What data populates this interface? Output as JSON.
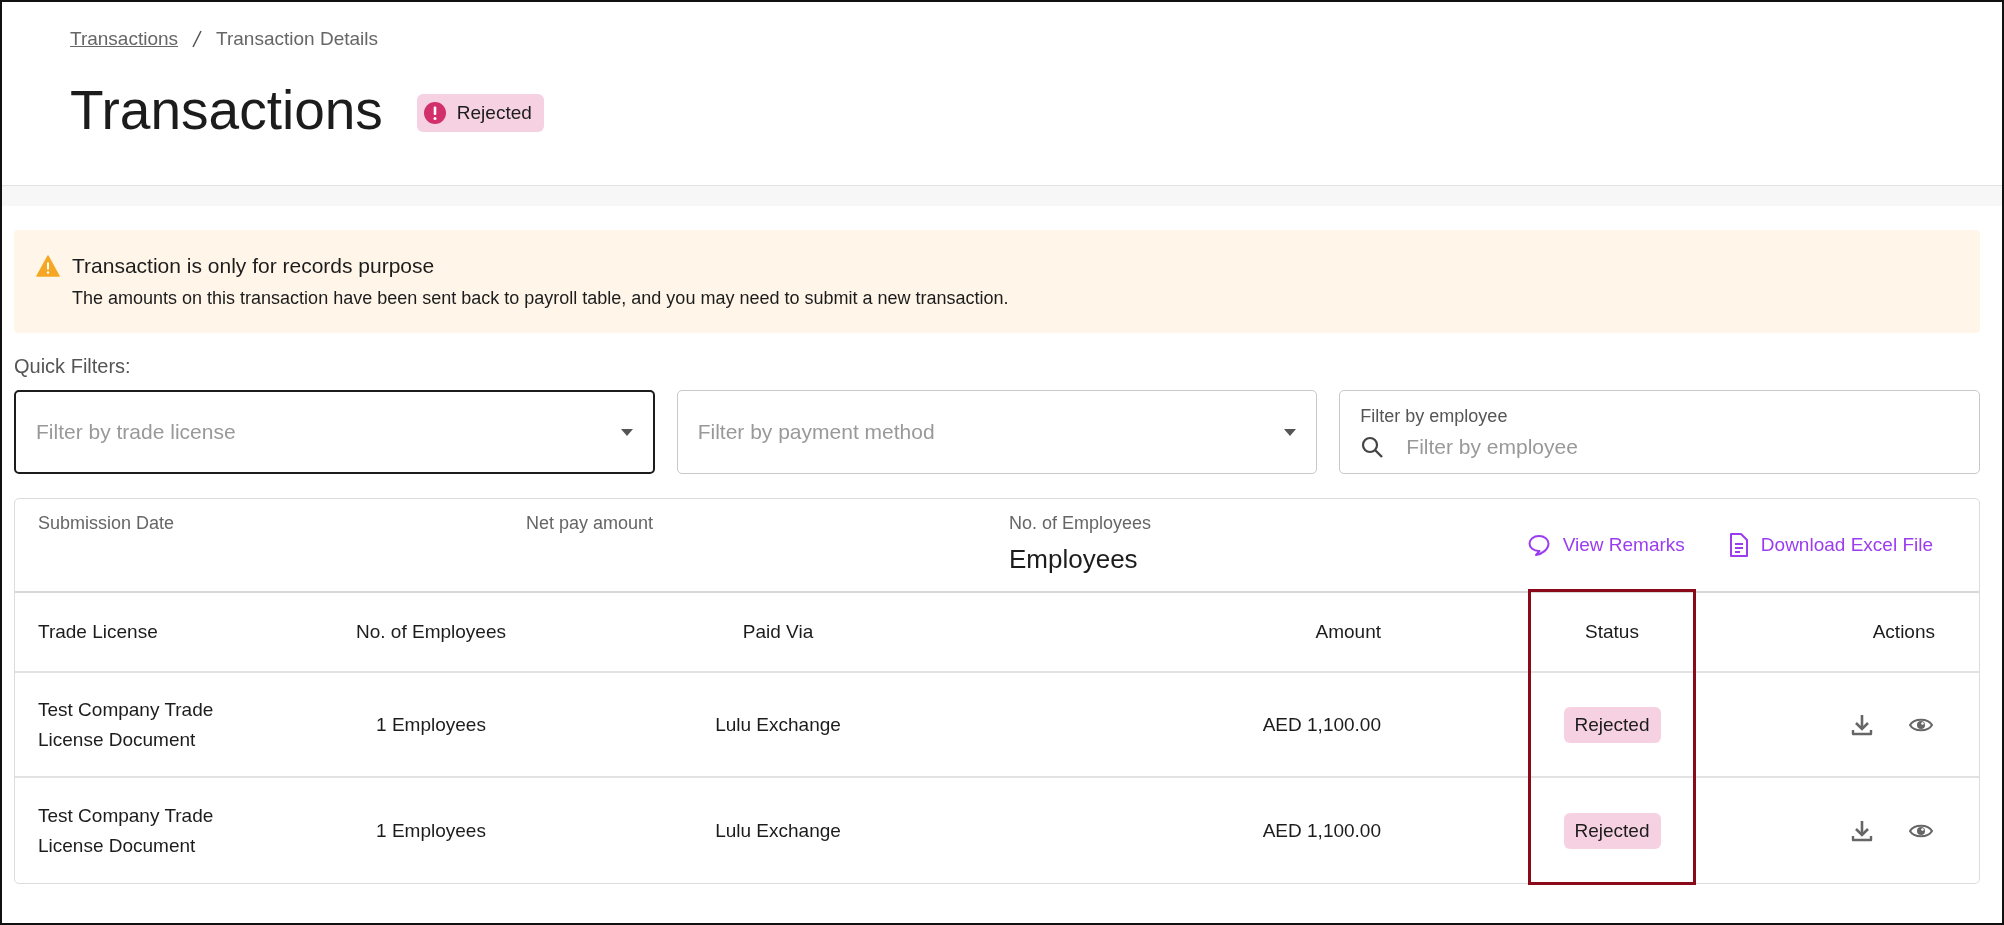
{
  "breadcrumb": [
    {
      "label": "Transactions",
      "link": true
    },
    {
      "label": "Transaction Details",
      "link": false
    }
  ],
  "page": {
    "title": "Transactions",
    "status": "Rejected"
  },
  "alert": {
    "kind": "warning",
    "title": "Transaction is only for records purpose",
    "message": "The amounts on this transaction have been sent back to payroll table, and you may need to submit a new transaction."
  },
  "quick_filters": {
    "label": "Quick Filters:",
    "filters": [
      {
        "kind": "dropdown",
        "placeholder": "Filter by trade license",
        "focused": true
      },
      {
        "kind": "dropdown",
        "placeholder": "Filter by payment method",
        "focused": false
      },
      {
        "kind": "search",
        "label": "Filter by employee",
        "placeholder": "Filter by employee",
        "focused": false
      }
    ]
  },
  "summary": {
    "fields": [
      {
        "label": "Submission Date"
      },
      {
        "label": "Net pay amount"
      },
      {
        "label": "No. of Employees",
        "value": "Employees"
      }
    ],
    "actions": [
      {
        "kind": "remarks",
        "label": "View Remarks"
      },
      {
        "kind": "file",
        "label": "Download Excel File"
      }
    ]
  },
  "table": {
    "columns": [
      {
        "label": "Trade License",
        "highlighted": false
      },
      {
        "label": "No. of Employees",
        "highlighted": false
      },
      {
        "label": "Paid Via",
        "highlighted": false
      },
      {
        "label": "Amount",
        "highlighted": false
      },
      {
        "label": "Status",
        "highlighted": true
      },
      {
        "label": "Actions",
        "highlighted": false
      }
    ],
    "rows": [
      {
        "trade_license": "Test Company Trade License Document",
        "employees": "1 Employees",
        "paid_via": "Lulu Exchange",
        "amount": "AED 1,100.00",
        "status": "Rejected"
      },
      {
        "trade_license": "Test Company Trade License Document",
        "employees": "1 Employees",
        "paid_via": "Lulu Exchange",
        "amount": "AED 1,100.00",
        "status": "Rejected"
      }
    ]
  }
}
